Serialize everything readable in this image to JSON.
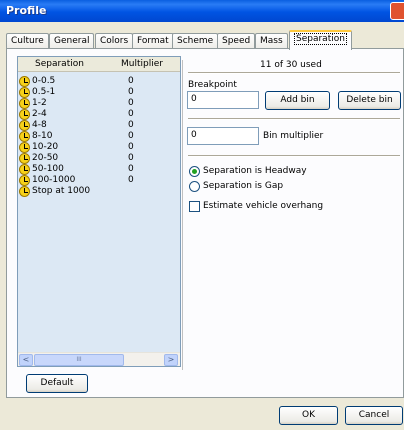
{
  "window": {
    "title": "Profile"
  },
  "tabs": [
    {
      "label": "Culture"
    },
    {
      "label": "General"
    },
    {
      "label": "Colors"
    },
    {
      "label": "Format"
    },
    {
      "label": "Scheme"
    },
    {
      "label": "Speed"
    },
    {
      "label": "Mass"
    },
    {
      "label": "Separation",
      "active": true
    }
  ],
  "list": {
    "headers": {
      "separation": "Separation",
      "multiplier": "Multiplier"
    },
    "rows": [
      {
        "label": "0-0.5",
        "multiplier": "0"
      },
      {
        "label": "0.5-1",
        "multiplier": "0"
      },
      {
        "label": "1-2",
        "multiplier": "0"
      },
      {
        "label": "2-4",
        "multiplier": "0"
      },
      {
        "label": "4-8",
        "multiplier": "0"
      },
      {
        "label": "8-10",
        "multiplier": "0"
      },
      {
        "label": "10-20",
        "multiplier": "0"
      },
      {
        "label": "20-50",
        "multiplier": "0"
      },
      {
        "label": "50-100",
        "multiplier": "0"
      },
      {
        "label": "100-1000",
        "multiplier": "0"
      },
      {
        "label": "Stop at 1000",
        "multiplier": ""
      }
    ],
    "scroll_left": "<",
    "scroll_right": ">",
    "scroll_thumb_grip": "III"
  },
  "right": {
    "used_text": "11 of 30 used",
    "breakpoint_label": "Breakpoint",
    "breakpoint_value": "0",
    "add_bin": "Add bin",
    "delete_bin": "Delete bin",
    "multiplier_value": "0",
    "bin_multiplier_label": "Bin multiplier",
    "radio_headway": "Separation is Headway",
    "radio_gap": "Separation is Gap",
    "estimate_overhang": "Estimate vehicle overhang"
  },
  "footer": {
    "default": "Default",
    "ok": "OK",
    "cancel": "Cancel"
  }
}
